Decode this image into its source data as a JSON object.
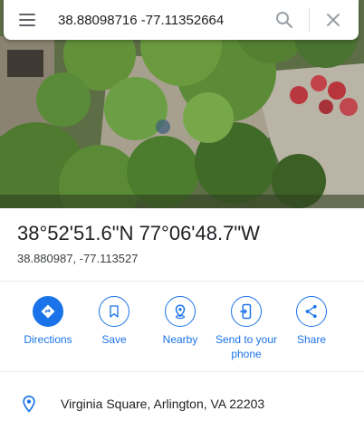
{
  "search": {
    "value": "38.88098716 -77.11352664"
  },
  "place": {
    "title": "38°52'51.6\"N 77°06'48.7\"W",
    "decimal": "38.880987, -77.113527"
  },
  "actions": [
    {
      "label": "Directions",
      "icon": "directions-icon",
      "primary": true
    },
    {
      "label": "Save",
      "icon": "bookmark-icon",
      "primary": false
    },
    {
      "label": "Nearby",
      "icon": "nearby-pin-icon",
      "primary": false
    },
    {
      "label": "Send to your phone",
      "icon": "phone-send-icon",
      "primary": false
    },
    {
      "label": "Share",
      "icon": "share-icon",
      "primary": false
    }
  ],
  "address": {
    "text": "Virginia Square, Arlington, VA 22203",
    "icon": "location-pin-icon"
  },
  "colors": {
    "accent": "#1a73e8",
    "text": "#202124",
    "secondary_text": "#3c4043",
    "icon_gray": "#5f6368"
  }
}
